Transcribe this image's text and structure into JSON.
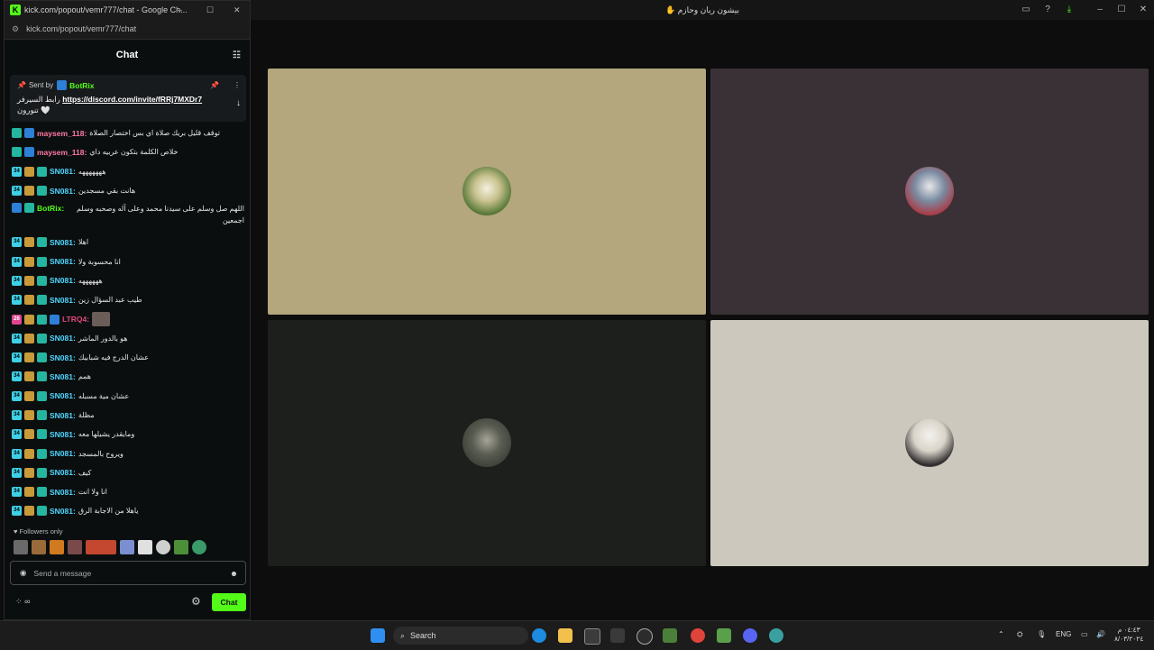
{
  "background_window": {
    "title": "بيشون ريان وحازم ✋",
    "controls": {
      "minimize": "–",
      "maximize": "☐",
      "close": "✕"
    }
  },
  "colors": {
    "kick_green": "#53fc18",
    "tile_1": "#b4a67d",
    "tile_2": "#3a3136",
    "tile_3": "#1c1f1c",
    "tile_4": "#cdc8bd"
  },
  "chat_window": {
    "title": "kick.com/popout/vemr777/chat - Google Ch...",
    "url": "kick.com/popout/vemr777/chat",
    "header": "Chat",
    "pinned": {
      "sent_by_label": "Sent by",
      "sender": "BotRix",
      "text_rtl": "رابط السيرفر",
      "link": "https://discord.com/invite/fRRj7MXDr7",
      "suffix": "تنورون 🤍"
    },
    "messages": [
      {
        "user": "maysem_118:",
        "color": "#ff7aa5",
        "text": "توقف قليل بريك صلاة اي بس اختصار الصلاة"
      },
      {
        "user": "maysem_118:",
        "color": "#ff7aa5",
        "text": "خلاص الكلمة بتكون عربيه داي"
      },
      {
        "user": "SN081:",
        "color": "#4fd7ff",
        "text": "هههههههه"
      },
      {
        "user": "SN081:",
        "color": "#4fd7ff",
        "text": "هانت بقي مسجدين"
      },
      {
        "user": "BotRix:",
        "color": "#53fc18",
        "text": "اللهم صل وسلم على سيدنا محمد وعلى آله وصحبه وسلم اجمعين"
      },
      {
        "user": "SN081:",
        "color": "#4fd7ff",
        "text": "اهلا"
      },
      {
        "user": "SN081:",
        "color": "#4fd7ff",
        "text": "انا محسوبة ولا"
      },
      {
        "user": "SN081:",
        "color": "#4fd7ff",
        "text": "ههههههه"
      },
      {
        "user": "SN081:",
        "color": "#4fd7ff",
        "text": "طيب عبد السؤال زين"
      },
      {
        "user": "LTRQ4:",
        "color": "#e2487a",
        "text": ""
      },
      {
        "user": "SN081:",
        "color": "#4fd7ff",
        "text": "هو بالدور الماشر"
      },
      {
        "user": "SN081:",
        "color": "#4fd7ff",
        "text": "عشان الدرج فيه شبابيك"
      },
      {
        "user": "SN081:",
        "color": "#4fd7ff",
        "text": "همم"
      },
      {
        "user": "SN081:",
        "color": "#4fd7ff",
        "text": "عشان مية مسبله"
      },
      {
        "user": "SN081:",
        "color": "#4fd7ff",
        "text": "مظلة"
      },
      {
        "user": "SN081:",
        "color": "#4fd7ff",
        "text": "ومايقدر يشيلها معه"
      },
      {
        "user": "SN081:",
        "color": "#4fd7ff",
        "text": "ويروح بالمسجد"
      },
      {
        "user": "SN081:",
        "color": "#4fd7ff",
        "text": "كيف"
      },
      {
        "user": "SN081:",
        "color": "#4fd7ff",
        "text": "انا ولا انت"
      },
      {
        "user": "SN081:",
        "color": "#4fd7ff",
        "text": "ياهلا من الاجابة الرق"
      }
    ],
    "followers_only": "Followers only",
    "input_placeholder": "Send a message",
    "send_label": "Chat",
    "points_value": "∞"
  },
  "taskbar": {
    "search_label": "Search",
    "language": "ENG",
    "time": "٠٤:٤٣ م",
    "date": "٨/٠٣/٢٠٢٤"
  }
}
